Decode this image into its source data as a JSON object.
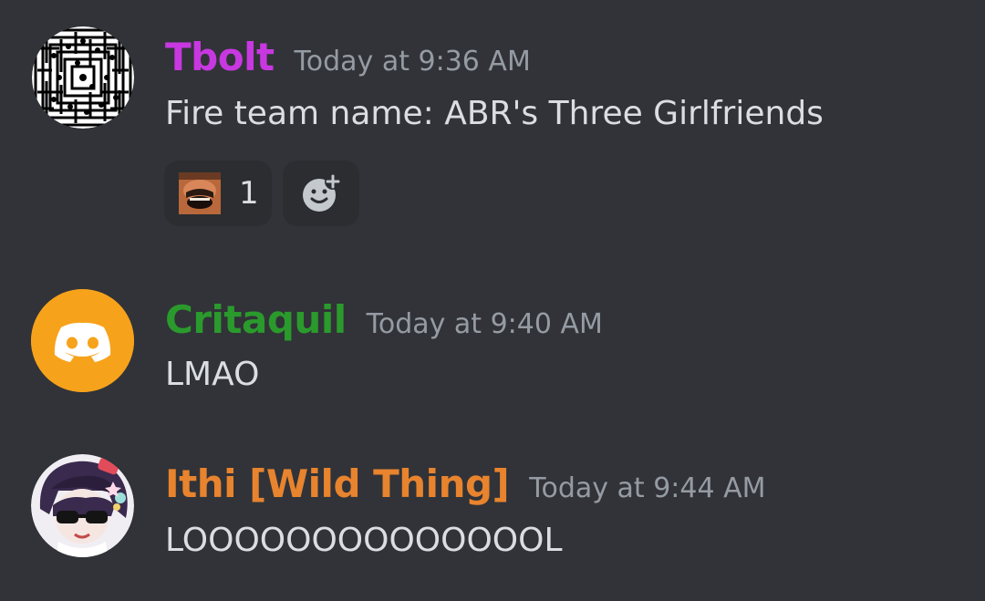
{
  "messages": [
    {
      "author": "Tbolt",
      "author_color": "#c838e0",
      "timestamp": "Today at 9:36 AM",
      "text": "Fire team name: ABR's Three Girlfriends",
      "avatar_icon": "maze-pattern-avatar",
      "reactions": [
        {
          "emoji": "laughing-man-emoji",
          "count": "1"
        }
      ],
      "add_reaction_icon": "add-reaction-icon"
    },
    {
      "author": "Critaquil",
      "author_color": "#2a9a2c",
      "timestamp": "Today at 9:40 AM",
      "text": "LMAO",
      "avatar_icon": "discord-logo-avatar",
      "avatar_color": "#f7a21b"
    },
    {
      "author": "Ithi [Wild Thing]",
      "author_color": "#e8832e",
      "timestamp": "Today at 9:44 AM",
      "text": "LOOOOOOOOOOOOOOL",
      "avatar_icon": "anime-sunglasses-avatar"
    }
  ]
}
